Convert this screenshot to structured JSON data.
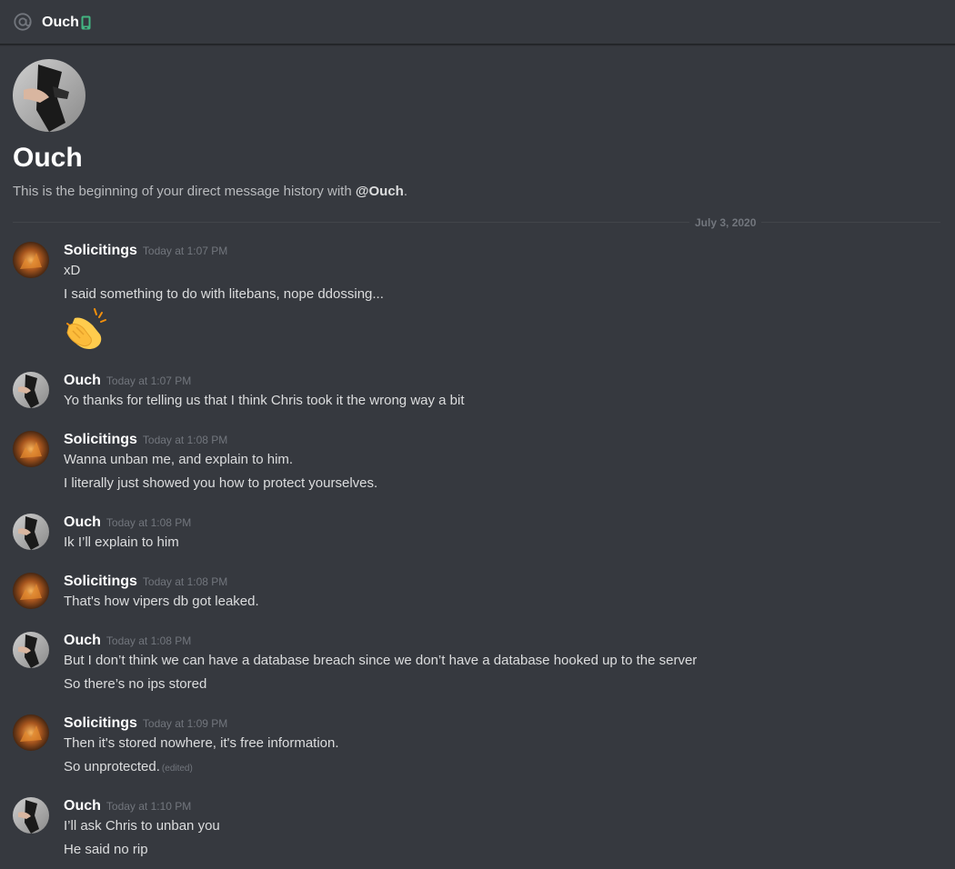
{
  "header": {
    "title": "Ouch",
    "at_icon": "at-icon",
    "status_icon": "mobile-phone-icon",
    "status_color": "#43b581"
  },
  "intro": {
    "name": "Ouch",
    "desc_prefix": "This is the beginning of your direct message history with ",
    "desc_mention": "@Ouch",
    "desc_suffix": "."
  },
  "divider": {
    "date": "July 3, 2020"
  },
  "messages": [
    {
      "author": "Solicitings",
      "time": "Today at 1:07 PM",
      "lines": [
        "xD",
        "I said something to do with litebans, nope ddossing..."
      ],
      "emoji": "clapping-hands-emoji"
    },
    {
      "author": "Ouch",
      "time": "Today at 1:07 PM",
      "lines": [
        "Yo thanks for telling us that I think Chris took it the wrong way a bit"
      ]
    },
    {
      "author": "Solicitings",
      "time": "Today at 1:08 PM",
      "lines": [
        "Wanna unban me, and explain to him.",
        "I literally just showed you how to protect yourselves."
      ]
    },
    {
      "author": "Ouch",
      "time": "Today at 1:08 PM",
      "lines": [
        "Ik I’ll explain to him"
      ]
    },
    {
      "author": "Solicitings",
      "time": "Today at 1:08 PM",
      "lines": [
        "That's how vipers db got leaked."
      ]
    },
    {
      "author": "Ouch",
      "time": "Today at 1:08 PM",
      "lines": [
        "But I don’t think we can have a database breach since we don’t have a database hooked up to the server",
        "So there’s no ips stored"
      ]
    },
    {
      "author": "Solicitings",
      "time": "Today at 1:09 PM",
      "lines": [
        "Then it's stored nowhere, it's free information.",
        "So unprotected."
      ],
      "edited_label": "(edited)"
    },
    {
      "author": "Ouch",
      "time": "Today at 1:10 PM",
      "lines": [
        "I’ll ask Chris to unban you",
        "He said no rip"
      ]
    }
  ]
}
